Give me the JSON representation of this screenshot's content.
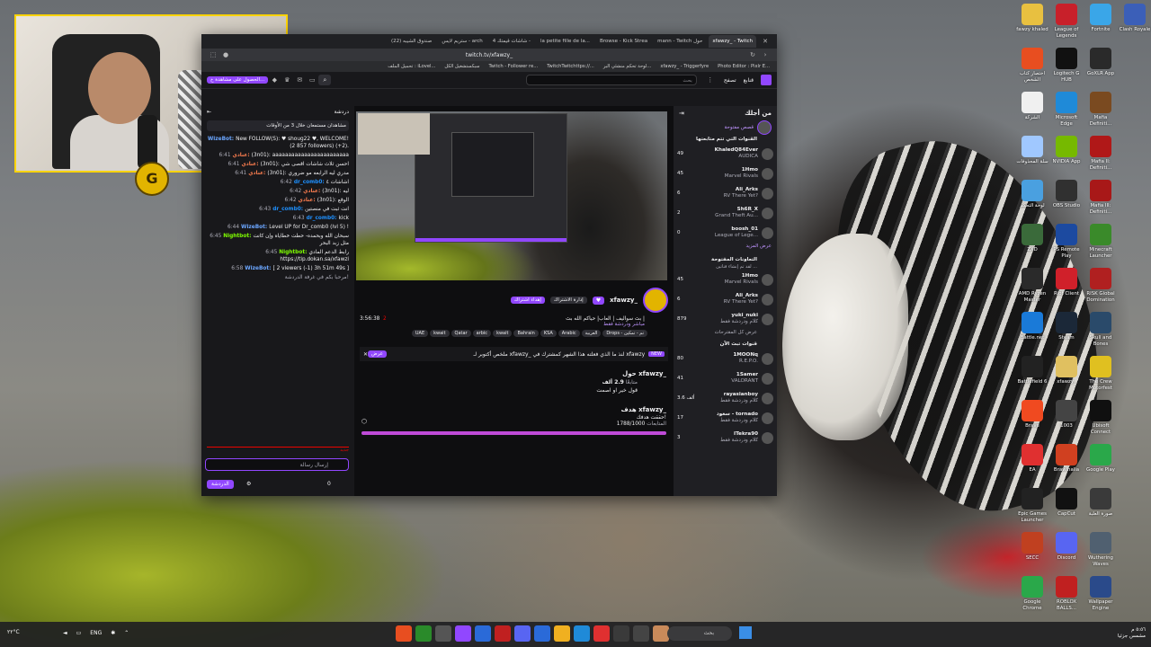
{
  "desktop_icons": [
    {
      "label": "Clash Royale",
      "color": "#3b5fb8"
    },
    {
      "label": "Fortnite",
      "color": "#3aa6e8"
    },
    {
      "label": "League of Legends",
      "color": "#c8202a"
    },
    {
      "label": "fawzy khaled",
      "color": "#e8c040"
    },
    {
      "label": "GoXLR App",
      "color": "#2a2a2a"
    },
    {
      "label": "Logitech G HUB",
      "color": "#111111"
    },
    {
      "label": "اختصار كتاب الشخص",
      "color": "#e84e20"
    },
    {
      "label": "Mafia Definiti...",
      "color": "#7a4a20"
    },
    {
      "label": "Microsoft Edge",
      "color": "#1f8ad8"
    },
    {
      "label": "الشركة",
      "color": "#f0f0f0"
    },
    {
      "label": "Mafia II: Definiti...",
      "color": "#b01818"
    },
    {
      "label": "NVIDIA App",
      "color": "#76b900"
    },
    {
      "label": "سلة المحذوفات",
      "color": "#a0c8ff"
    },
    {
      "label": "Mafia III: Definiti...",
      "color": "#a81818"
    },
    {
      "label": "OBS Studio",
      "color": "#303030"
    },
    {
      "label": "لوحة التحكم",
      "color": "#4aa0e0"
    },
    {
      "label": "Minecraft Launcher",
      "color": "#3a8a2a"
    },
    {
      "label": "PS Remote Play",
      "color": "#1c4aa0"
    },
    {
      "label": "ZXD",
      "color": "#3a6a3a"
    },
    {
      "label": "RISK Global Domination",
      "color": "#b02020"
    },
    {
      "label": "Riot Client",
      "color": "#d0202a"
    },
    {
      "label": "AMD Ryzen Master",
      "color": "#2a2a2a"
    },
    {
      "label": "Skull and Bones",
      "color": "#2a4a6a"
    },
    {
      "label": "Steam",
      "color": "#1b2838"
    },
    {
      "label": "Battle.net",
      "color": "#1a7ad8"
    },
    {
      "label": "The Crew Motorfest",
      "color": "#e0c020"
    },
    {
      "label": "xfawzy_",
      "color": "#e0c060"
    },
    {
      "label": "Battlefield 6",
      "color": "#222222"
    },
    {
      "label": "Ubisoft Connect",
      "color": "#101010"
    },
    {
      "label": "1003",
      "color": "#444444"
    },
    {
      "label": "Brave",
      "color": "#f04a20"
    },
    {
      "label": "Google Play",
      "color": "#2aa84a"
    },
    {
      "label": "Brawlhalla",
      "color": "#d04020"
    },
    {
      "label": "EA",
      "color": "#e03030"
    },
    {
      "label": "صورة العلبة",
      "color": "#3a3a3a"
    },
    {
      "label": "CapCut",
      "color": "#111111"
    },
    {
      "label": "Epic Games Launcher",
      "color": "#222222"
    },
    {
      "label": "Wuthering Waves",
      "color": "#506070"
    },
    {
      "label": "Discord",
      "color": "#5865f2"
    },
    {
      "label": "SECC",
      "color": "#c04020"
    },
    {
      "label": "Wallpaper Engine",
      "color": "#2a4a8a"
    },
    {
      "label": "ROBLOX BALLS...",
      "color": "#c02020"
    },
    {
      "label": "Google Chrome",
      "color": "#2aa84a"
    }
  ],
  "webcam": {
    "badge": "G"
  },
  "browser": {
    "tabs": [
      "xfawzy_ - Twitch",
      "mann - Twitch حول",
      "Browse - Kick Strea",
      "la petite fille de la...",
      "شاشات قيمتك 4 -",
      "ستريم لايس - arch",
      "(22) صندوق الشيبه"
    ],
    "url": "twitch.tv/xfawzy_",
    "bookmarks": [
      "Photo Editor : Pixlr E...",
      "xfawzy_ - Triggerfyre",
      "لوحة تحكم منشئي البر...",
      "TwitchTwitchttps://...",
      "Twitch - Follower re...",
      "سبكستشغيل الكل",
      "تحميل الملف : iLovel..."
    ],
    "nav": {
      "follow": "قنابع",
      "browse": "تصفح",
      "search_placeholder": "بحث",
      "get_ad_free": "الحصول على مشاهدة خ..."
    }
  },
  "chat": {
    "header_left": "دردشة",
    "notice": "مشاهدان مستمعان خلال 3 من الأوقات",
    "lines": [
      {
        "time": "",
        "user": "WizeBot",
        "color": "#6ba6ff",
        "text": "New FOLLOW(S): ♥ shoug22 ♥, WELCOME! (2 857 followers) (+2)."
      },
      {
        "time": "6:41",
        "user": "عنادي",
        "color": "#ff7f50",
        "text": "(3n01): aaaaaaaaaaaaaaaaaaaaaaaa"
      },
      {
        "time": "6:41",
        "user": "عنادي",
        "color": "#ff7f50",
        "text": "(3n01): احسن ثلاث شاشات اقصى شي"
      },
      {
        "time": "6:41",
        "user": "عنادي",
        "color": "#ff7f50",
        "text": "(3n01): مدري ليه الرابعه مو ضروري"
      },
      {
        "time": "6:42",
        "user": "dr_comb0",
        "color": "#1e90ff",
        "text": "اشاشات ٤"
      },
      {
        "time": "6:42",
        "user": "عنادي",
        "color": "#ff7f50",
        "text": "(3n01): ليه"
      },
      {
        "time": "6:42",
        "user": "عنادي",
        "color": "#ff7f50",
        "text": "(3n01): الوقع"
      },
      {
        "time": "6:43",
        "user": "dr_comb0",
        "color": "#1e90ff",
        "text": "انت ثبت في منصتين"
      },
      {
        "time": "6:43",
        "user": "dr_comb0",
        "color": "#1e90ff",
        "text": "kick"
      },
      {
        "time": "6:44",
        "user": "WizeBot",
        "color": "#6ba6ff",
        "text": "Level UP for Dr_comb0 (lvl 5) !"
      },
      {
        "time": "6:45",
        "user": "Nightbot",
        "color": "#7fff00",
        "text": "سبحان الله وبحمده- حطت خطاياه وإن كانت مثل زبد البحر"
      },
      {
        "time": "6:45",
        "user": "Nightbot",
        "color": "#7fff00",
        "text": "رابط الدعم المادي https://tip.dokan.sa/xfawzi"
      },
      {
        "time": "6:58",
        "user": "WizeBot",
        "color": "#6ba6ff",
        "text": "[ 2 viewers (-1) 3h 51m 49s ]"
      },
      {
        "time": "",
        "user": "",
        "color": "#adadb8",
        "text": "مرحبا بكم في غرفة الدردشة!"
      }
    ],
    "new_label": "جديد",
    "input_placeholder": "إرسال رسالة",
    "send_button": "الدردشة",
    "points": "0"
  },
  "stream": {
    "channel": "xfawzy_",
    "title": "بث سواليف | العاب| حياكم الله بث |",
    "category": "مباشر ودردشة فقط",
    "viewers": "2",
    "uptime": "3:56:38",
    "follow_button": "إدارة الاشتراك",
    "gift_button": "إهداء اشتراك",
    "tags": [
      "UAE",
      "kwait",
      "Qatar",
      "arbic",
      "kwait",
      "Bahrain",
      "KSA",
      "Arabic",
      "العربية",
      "Drops - تم - تمكين"
    ],
    "promo_badge": "NEW",
    "promo_text": "ملخص أكتوبر لـ xfawzy_ لنذ ما الذي فعلته هذا الشهر كمشترك في xfawzy",
    "promo_btn": "عرض",
    "about_heading": "حول xfawzy_",
    "followers": "2.9 ألف",
    "followers_label": "متابعًا",
    "bio": "قول خير او اصمت",
    "goal_heading": "هدف xfawzy_",
    "goal_title": "حققت هدفك!",
    "goal_progress": "1788/1000",
    "goal_unit": "المتابعات",
    "goal_percent": 1.0
  },
  "sidebar": {
    "header": "من أجلك",
    "story_label": "قصص مفتوحة",
    "followed_heading": "القنوات التي تتم متابعتها",
    "followed": [
      {
        "name": "KhaledQ84Ever",
        "game": "AUDICA",
        "count": "49"
      },
      {
        "name": "1Hmo",
        "game": "Marvel Rivals",
        "count": "45"
      },
      {
        "name": "Ali_Arks",
        "game": "RV There Yet?",
        "count": "6"
      },
      {
        "name": "Sh6R_X",
        "game": "Grand Theft Au...",
        "count": "2"
      },
      {
        "name": "boosh_01",
        "game": "League of Lege...",
        "count": "0"
      }
    ],
    "show_more": "عرض المزيد",
    "collab_heading": "التعاونات المفتوحة",
    "collab_sub": "لقد تم إنشاء قناتين ...",
    "collab": [
      {
        "name": "1Hmo",
        "game": "Marvel Rivals",
        "count": "45"
      },
      {
        "name": "Ali_Arks",
        "game": "RV There Yet?",
        "count": "6"
      },
      {
        "name": "yuki_nuki",
        "game": "كلام ودردشة فقط",
        "count": "879"
      }
    ],
    "show_all": "عرض كل المقترحات",
    "live_heading": "قنوات تبث الآن",
    "live": [
      {
        "name": "1MOONq",
        "game": "R.E.P.O.",
        "count": "80"
      },
      {
        "name": "1Samer",
        "game": "VALORANT",
        "count": "41"
      },
      {
        "name": "rayasianboy",
        "game": "كلام ودردشة فقط",
        "count": "3.6 ألف"
      },
      {
        "name": "سعود - tornado",
        "game": "كلام ودردشة فقط",
        "count": "17"
      },
      {
        "name": "ITekra90",
        "game": "كلام ودردشة فقط",
        "count": "3"
      }
    ]
  },
  "taskbar": {
    "left": "٢٢°C",
    "lang": "ENG",
    "search": "بحث",
    "time": "٥:٥٦ م",
    "date": "مشمس جزئيا"
  }
}
